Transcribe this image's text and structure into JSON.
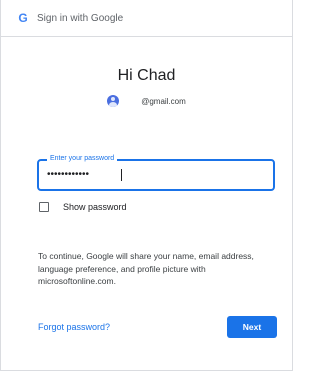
{
  "window": {
    "title": "Sign in with Google",
    "logo_letter": "G"
  },
  "greeting": "Hi Chad",
  "account": {
    "avatar_icon": "person-avatar-icon",
    "email": "@gmail.com"
  },
  "password": {
    "label": "Enter your password",
    "value": "••••••••••••"
  },
  "show_password": {
    "label": "Show password",
    "checked": false
  },
  "info_text": "To continue, Google will share your name, email address, language preference, and profile picture with microsoftonline.com.",
  "actions": {
    "forgot_label": "Forgot password?",
    "next_label": "Next"
  },
  "colors": {
    "accent": "#1a73e8",
    "avatar": "#4a6ee0"
  }
}
